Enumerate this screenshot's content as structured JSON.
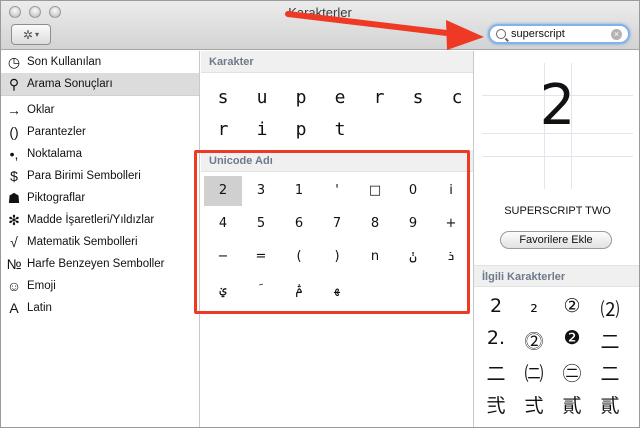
{
  "window": {
    "title": "Karakterler"
  },
  "toolbar": {
    "gear_glyph": "✲",
    "caret_glyph": "▾"
  },
  "search": {
    "value": "superscript",
    "clear_glyph": "×"
  },
  "sidebar": {
    "items": [
      {
        "icon": "clock-icon",
        "glyph": "◷",
        "label": "Son Kullanılan"
      },
      {
        "icon": "magnifier-icon",
        "glyph": "⚲",
        "label": "Arama Sonuçları"
      },
      {
        "icon": "arrow-icon",
        "glyph": "→",
        "label": "Oklar"
      },
      {
        "icon": "parentheses-icon",
        "glyph": "()",
        "label": "Parantezler"
      },
      {
        "icon": "punctuation-icon",
        "glyph": "•,",
        "label": "Noktalama"
      },
      {
        "icon": "dollar-icon",
        "glyph": "$",
        "label": "Para Birimi Sembolleri"
      },
      {
        "icon": "pictograph-icon",
        "glyph": "☗",
        "label": "Piktograflar"
      },
      {
        "icon": "asterisk-icon",
        "glyph": "✻",
        "label": "Madde İşaretleri/Yıldızlar"
      },
      {
        "icon": "square-root-icon",
        "glyph": "√",
        "label": "Matematik Sembolleri"
      },
      {
        "icon": "numero-icon",
        "glyph": "№",
        "label": "Harfe Benzeyen Semboller"
      },
      {
        "icon": "smiley-icon",
        "glyph": "☺",
        "label": "Emoji"
      },
      {
        "icon": "latin-a-icon",
        "glyph": "A",
        "label": "Latin"
      }
    ]
  },
  "characters": {
    "header": "Karakter",
    "rows": [
      [
        "s",
        "u",
        "p",
        "e",
        "r",
        "s",
        "c"
      ],
      [
        "r",
        "i",
        "p",
        "t"
      ]
    ]
  },
  "unicode": {
    "header": "Unicode Adı",
    "rows": [
      [
        "2",
        "3",
        "1",
        "'",
        "□",
        "0",
        "i"
      ],
      [
        "4",
        "5",
        "6",
        "7",
        "8",
        "9",
        "+"
      ],
      [
        "−",
        "=",
        "(",
        ")",
        "n",
        "ݩ",
        "ܪ"
      ],
      [
        "ࢩ",
        "ﹶ",
        "ࢧ",
        "ﮭ"
      ]
    ]
  },
  "detail": {
    "preview": "2",
    "name": "SUPERSCRIPT TWO",
    "favorite_button": "Favorilere Ekle"
  },
  "related": {
    "header": "İlgili Karakterler",
    "rows": [
      [
        "2",
        "₂",
        "②",
        "⑵"
      ],
      [
        "2.",
        "⓶",
        "❷",
        "二"
      ],
      [
        "二",
        "㈡",
        "㊁",
        "二"
      ],
      [
        "弐",
        "弍",
        "貳",
        "貳"
      ]
    ]
  },
  "colors": {
    "annotation_red": "#ee3a24",
    "search_focus": "#86b3e6",
    "section_header_text": "#6d7a8a"
  }
}
